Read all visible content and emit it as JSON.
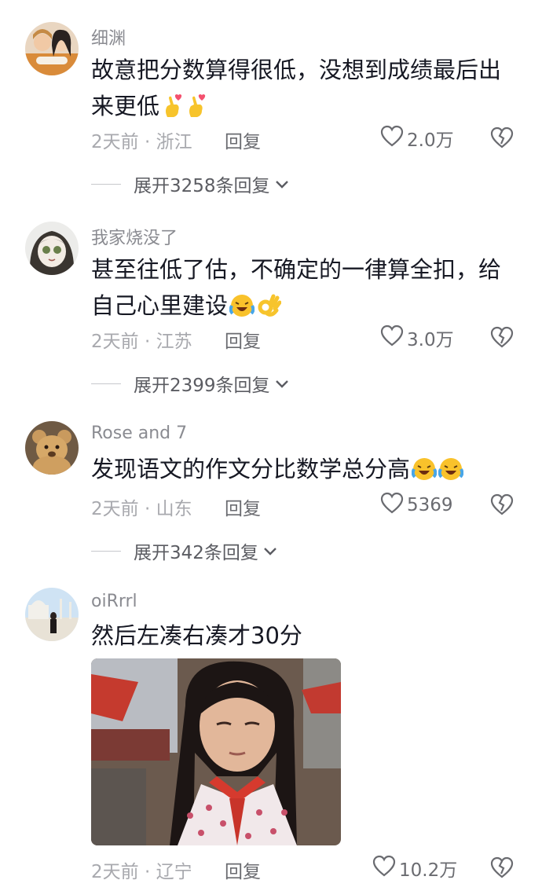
{
  "comments": [
    {
      "username": "细渊",
      "text": "故意把分数算得很低，没想到成绩最后出来更低",
      "time": "2天前",
      "location": "浙江",
      "reply_label": "回复",
      "likes": "2.0万",
      "expand_label": "展开3258条回复",
      "emojis": [
        "finger-heart-emoji",
        "finger-heart-emoji"
      ]
    },
    {
      "username": "我家烧没了",
      "text": "甚至往低了估，不确定的一律算全扣，给自己心里建设",
      "time": "2天前",
      "location": "江苏",
      "reply_label": "回复",
      "likes": "3.0万",
      "expand_label": "展开2399条回复",
      "emojis": [
        "laughing-tears-emoji",
        "ok-hand-emoji"
      ]
    },
    {
      "username": "Rose and 7",
      "text": "发现语文的作文分比数学总分高",
      "time": "2天前",
      "location": "山东",
      "reply_label": "回复",
      "likes": "5369",
      "expand_label": "展开342条回复",
      "emojis": [
        "laughing-tears-emoji",
        "laughing-tears-emoji"
      ]
    },
    {
      "username": "oiRrrl",
      "text": "然后左凑右凑才30分",
      "time": "2天前",
      "location": "辽宁",
      "reply_label": "回复",
      "likes": "10.2万",
      "emojis": []
    }
  ],
  "separator": "·",
  "icons": {
    "like": "heart-outline-icon",
    "dislike": "broken-heart-icon",
    "expand": "chevron-down-icon"
  },
  "colors": {
    "text": "#161823",
    "secondary": "#8a8b91",
    "muted": "#a8a9ae",
    "background": "#ffffff"
  }
}
